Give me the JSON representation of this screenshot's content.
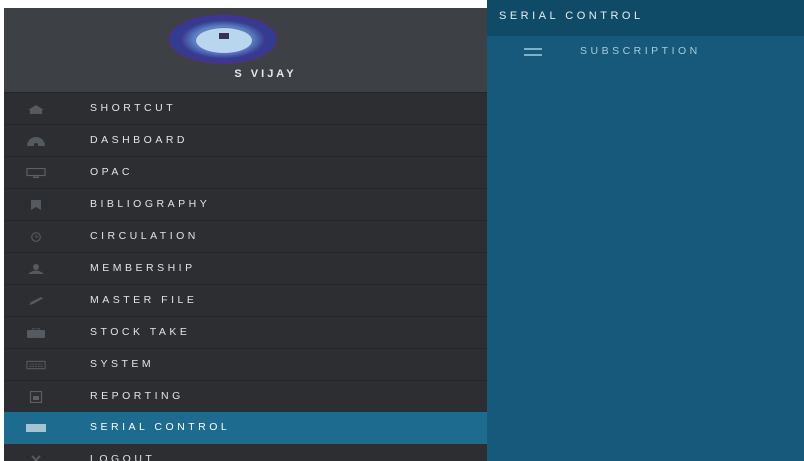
{
  "user": {
    "name": "S VIJAY"
  },
  "sidebar": {
    "items": [
      {
        "label": "SHORTCUT",
        "icon": "home-icon"
      },
      {
        "label": "DASHBOARD",
        "icon": "dashboard-icon"
      },
      {
        "label": "OPAC",
        "icon": "monitor-icon"
      },
      {
        "label": "BIBLIOGRAPHY",
        "icon": "bookmark-icon"
      },
      {
        "label": "CIRCULATION",
        "icon": "clock-icon"
      },
      {
        "label": "MEMBERSHIP",
        "icon": "user-icon"
      },
      {
        "label": "MASTER FILE",
        "icon": "pencil-icon"
      },
      {
        "label": "STOCK TAKE",
        "icon": "briefcase-icon"
      },
      {
        "label": "SYSTEM",
        "icon": "keyboard-icon"
      },
      {
        "label": "REPORTING",
        "icon": "file-icon"
      },
      {
        "label": "SERIAL CONTROL",
        "icon": "barcode-icon",
        "active": true
      },
      {
        "label": "LOGOUT",
        "icon": "close-icon"
      }
    ]
  },
  "main": {
    "title": "SERIAL CONTROL",
    "submenu": [
      {
        "label": "SUBSCRIPTION",
        "icon": "hamburger-icon"
      }
    ]
  },
  "colors": {
    "sidebar_bg": "#2c2e31",
    "profile_bg": "#3d4044",
    "active_bg": "#1d6b8f",
    "main_bg": "#16597a",
    "main_header_bg": "#0f4a66"
  }
}
